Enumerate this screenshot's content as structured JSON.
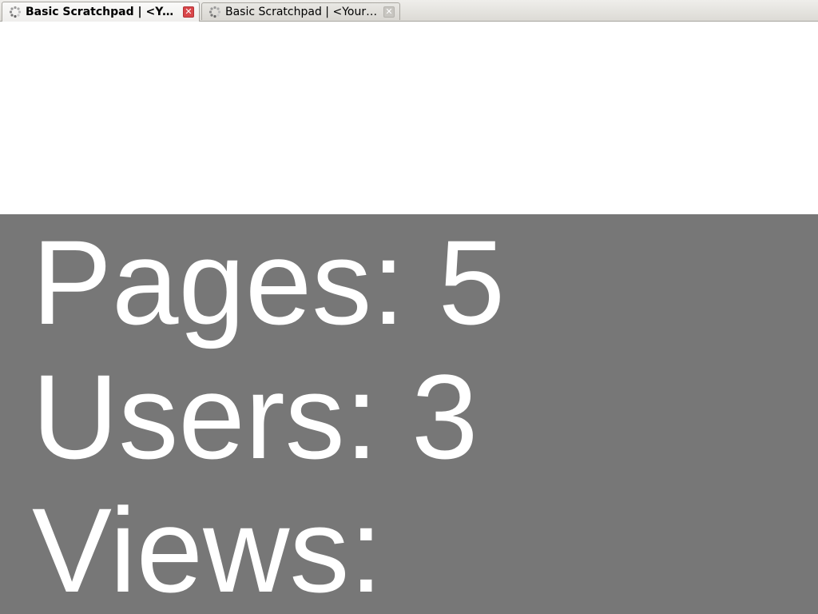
{
  "tabs": [
    {
      "title": "Basic Scratchpad | <Your slide title>",
      "active": true,
      "close_icon": "close-icon"
    },
    {
      "title": "Basic Scratchpad | <Your slide title>",
      "active": false,
      "close_icon": "close-icon"
    }
  ],
  "tab_icons": {
    "loading": "throbber-icon"
  },
  "stats": {
    "pages": "Pages: 5",
    "users": "Users: 3",
    "views": "Views:"
  },
  "colors": {
    "panel_background": "#777777",
    "stats_text": "#ffffff",
    "active_close": "#d9474a"
  }
}
